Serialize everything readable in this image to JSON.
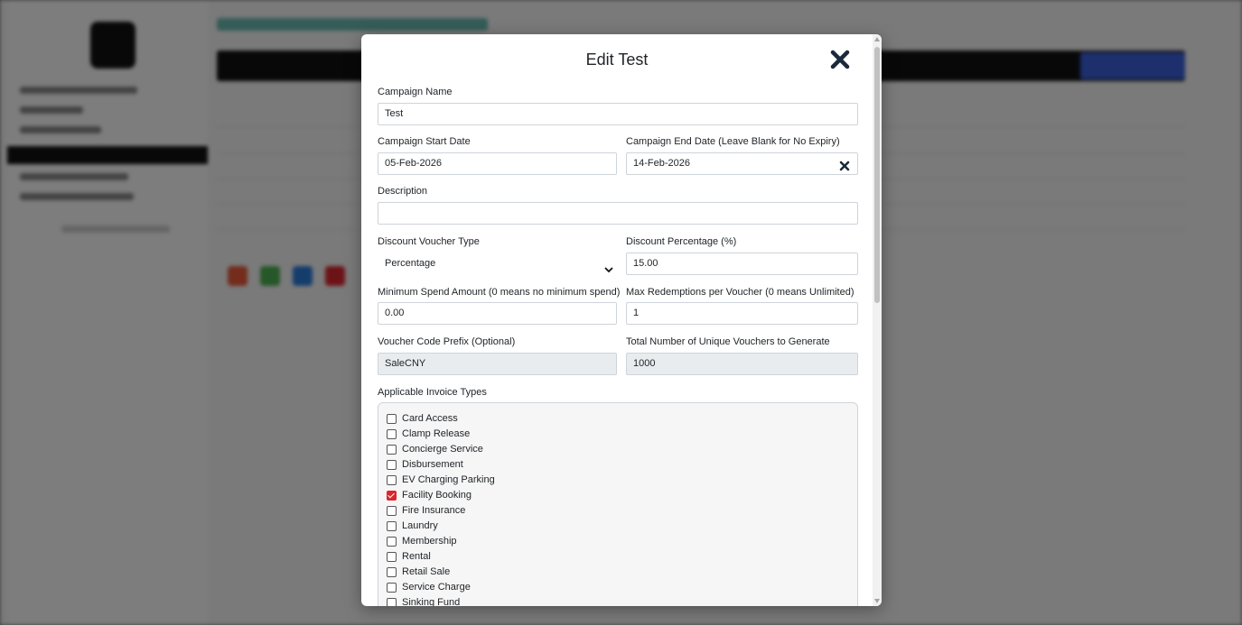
{
  "modal": {
    "title": "Edit Test",
    "close_icon": "close-icon"
  },
  "form": {
    "campaign_name": {
      "label": "Campaign Name",
      "value": "Test"
    },
    "start_date": {
      "label": "Campaign Start Date",
      "value": "05-Feb-2026"
    },
    "end_date": {
      "label": "Campaign End Date (Leave Blank for No Expiry)",
      "value": "14-Feb-2026"
    },
    "description": {
      "label": "Description",
      "value": ""
    },
    "voucher_type": {
      "label": "Discount Voucher Type",
      "value": "Percentage"
    },
    "discount_pct": {
      "label": "Discount Percentage (%)",
      "value": "15.00"
    },
    "min_spend": {
      "label": "Minimum Spend Amount (0 means no minimum spend)",
      "value": "0.00"
    },
    "max_redemptions": {
      "label": "Max Redemptions per Voucher (0 means Unlimited)",
      "value": "1"
    },
    "code_prefix": {
      "label": "Voucher Code Prefix (Optional)",
      "value": "SaleCNY"
    },
    "total_vouchers": {
      "label": "Total Number of Unique Vouchers to Generate",
      "value": "1000"
    },
    "invoice_types": {
      "label": "Applicable Invoice Types",
      "items": [
        {
          "label": "Card Access",
          "checked": false
        },
        {
          "label": "Clamp Release",
          "checked": false
        },
        {
          "label": "Concierge Service",
          "checked": false
        },
        {
          "label": "Disbursement",
          "checked": false
        },
        {
          "label": "EV Charging Parking",
          "checked": false
        },
        {
          "label": "Facility Booking",
          "checked": true
        },
        {
          "label": "Fire Insurance",
          "checked": false
        },
        {
          "label": "Laundry",
          "checked": false
        },
        {
          "label": "Membership",
          "checked": false
        },
        {
          "label": "Rental",
          "checked": false
        },
        {
          "label": "Retail Sale",
          "checked": false
        },
        {
          "label": "Service Charge",
          "checked": false
        },
        {
          "label": "Sinking Fund",
          "checked": false
        }
      ]
    }
  },
  "colors": {
    "checkbox_checked": "#d9272e",
    "readonly_bg": "#e9ecef",
    "overlay": "rgba(0,0,0,0.5)"
  }
}
